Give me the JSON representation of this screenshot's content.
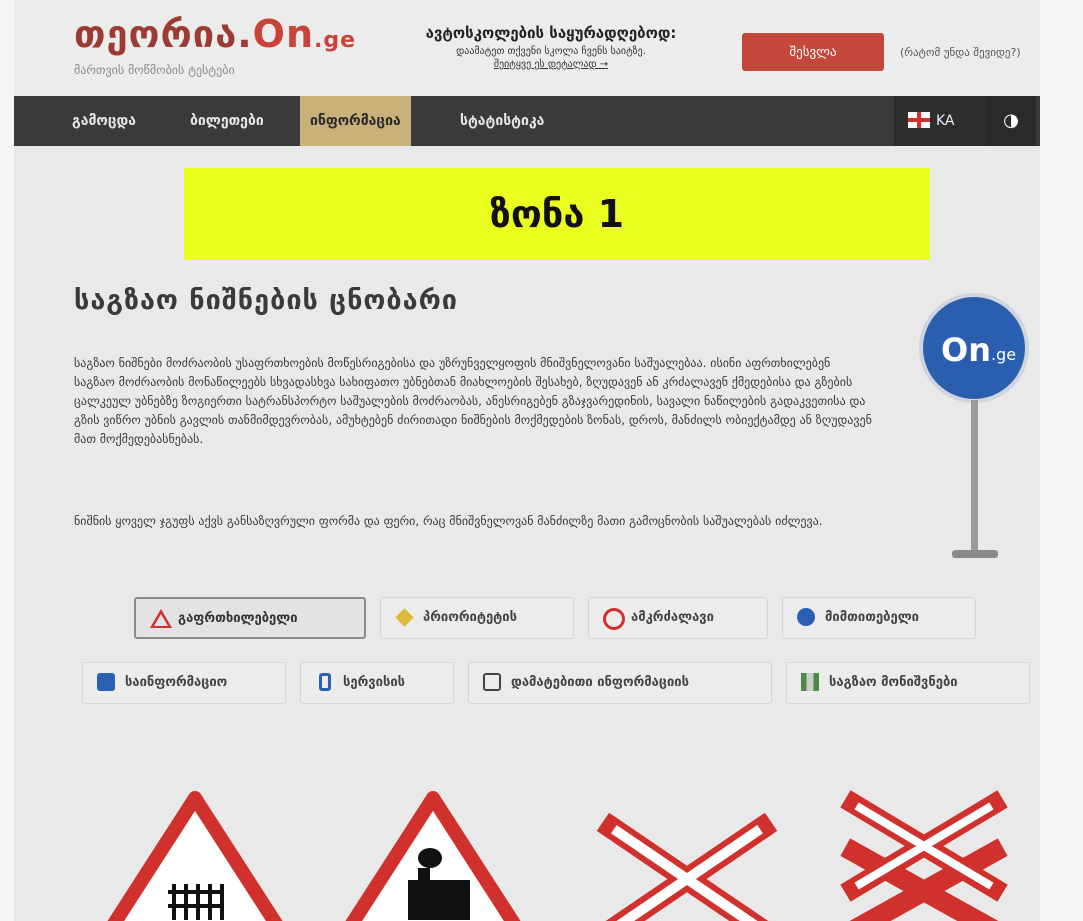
{
  "header": {
    "logo_main": "თეორია.",
    "logo_on": "On",
    "logo_ge": ".ge",
    "logo_tagline": "მართვის მოწმობის ტესტები",
    "promo_title": "ავტოსკოლების საყურადღებოდ:",
    "promo_text": "დაამატეთ თქვენი სკოლა ჩვენს საიტზე.",
    "promo_link": "შეიტყვე ეს დეტალად →",
    "login_button": "შესვლა",
    "why_link": "(რატომ უნდა შევიდე?)"
  },
  "nav": {
    "items": [
      {
        "label": "გამოცდა"
      },
      {
        "label": "ბილეთები"
      },
      {
        "label": "ინფორმაცია"
      },
      {
        "label": "სტატისტიკა"
      }
    ],
    "active_index": 2,
    "lang_code": "KA",
    "contrast_icon": "◑"
  },
  "zone": {
    "label": "ზონა 1"
  },
  "main": {
    "title": "საგზაო ნიშნების ცნობარი",
    "paragraph1": "საგზაო ნიშნები მოძრაობის უსაფრთხოების მოწესრიგებისა და უზრუნველყოფის მნიშვნელოვანი საშუალებაა. ისინი აფრთხილებენ საგზაო მოძრაობის მონაწილეებს სხვადასხვა სახიფათო უბნებთან მიახლოების შესახებ, ზღუდავენ ან კრძალავენ ქმედებისა და გზების ცალკეულ უბნებზე ზოგიერთი სატრანსპორტო საშუალების მოძრაობას, ანესრიგებენ გზაჯვარედინის, სავალი ნაწილების გადაკვეთისა და გზის ვიწრო უბნის გავლის თანმიმდევრობას, ამუხტებენ ძირითადი ნიშნების მოქმედების ზონას, დროს, მანძილს ობიექტამდე ან ზღუდავენ მათ მოქმედებასნებას.",
    "paragraph2": "ნიშნის ყოველ ჯგუფს აქვს განსაზღვრული ფორმა და ფერი, რაც მნიშვნელოვან მანძილზე მათი გამოცნობის საშუალებას იძლევა.",
    "side_sign_on": "On",
    "side_sign_ge": ".ge"
  },
  "categories": {
    "row1": [
      {
        "label": "გაფრთხილებელი",
        "icon": "warning-triangle-icon"
      },
      {
        "label": "პრიორიტეტის",
        "icon": "priority-diamond-icon"
      },
      {
        "label": "ამკრძალავი",
        "icon": "prohibitory-ring-icon"
      },
      {
        "label": "მიმთითებელი",
        "icon": "mandatory-circle-icon"
      }
    ],
    "row2": [
      {
        "label": "საინფორმაციო",
        "icon": "information-square-icon"
      },
      {
        "label": "სერვისის",
        "icon": "service-icon"
      },
      {
        "label": "დამატებითი ინფორმაციის",
        "icon": "additional-info-icon"
      },
      {
        "label": "საგზაო მონიშვნები",
        "icon": "road-marking-icon"
      }
    ],
    "selected": "გაფრთხილებელი"
  },
  "colors": {
    "accent_red": "#c4473b",
    "nav_bg": "#3a3a3a",
    "nav_active": "#c8b27a",
    "zone_bg": "#eaff1f",
    "sign_blue": "#2a5fb0"
  }
}
